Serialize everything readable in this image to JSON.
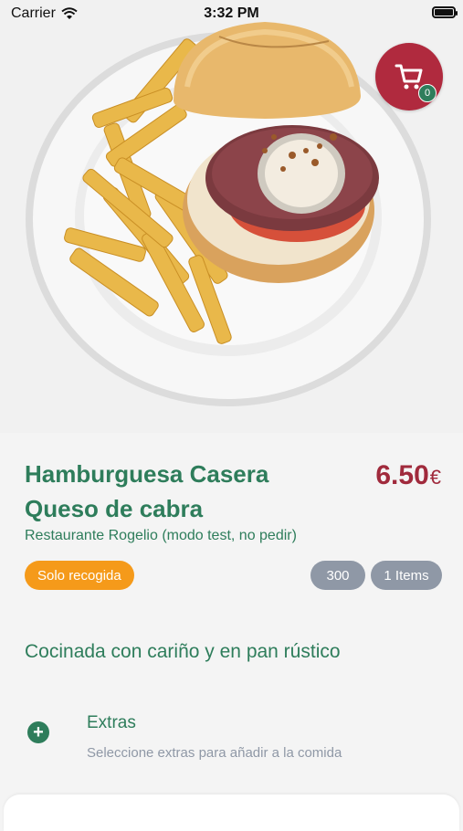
{
  "status_bar": {
    "carrier": "Carrier",
    "time": "3:32 PM"
  },
  "cart": {
    "count": "0",
    "icon": "cart-icon",
    "color": "#b02a3e"
  },
  "product": {
    "title_line1": "Hamburguesa Casera",
    "title_line2": "Queso de cabra",
    "price": "6.50",
    "currency": "€",
    "restaurant": "Restaurante Rogelio  (modo test, no pedir)",
    "pickup_badge": "Solo recogida",
    "calories": "300",
    "items": "1 Items",
    "description": "Cocinada con cariño y en pan rústico"
  },
  "extras": {
    "title": "Extras",
    "subtitle": "Seleccione extras para añadir a la comida",
    "icon": "plus-circle-icon"
  },
  "colors": {
    "primary_green": "#2e7d5b",
    "price_red": "#a02a3c",
    "pickup_orange": "#f59a1a",
    "pill_gray": "#8f98a6"
  }
}
